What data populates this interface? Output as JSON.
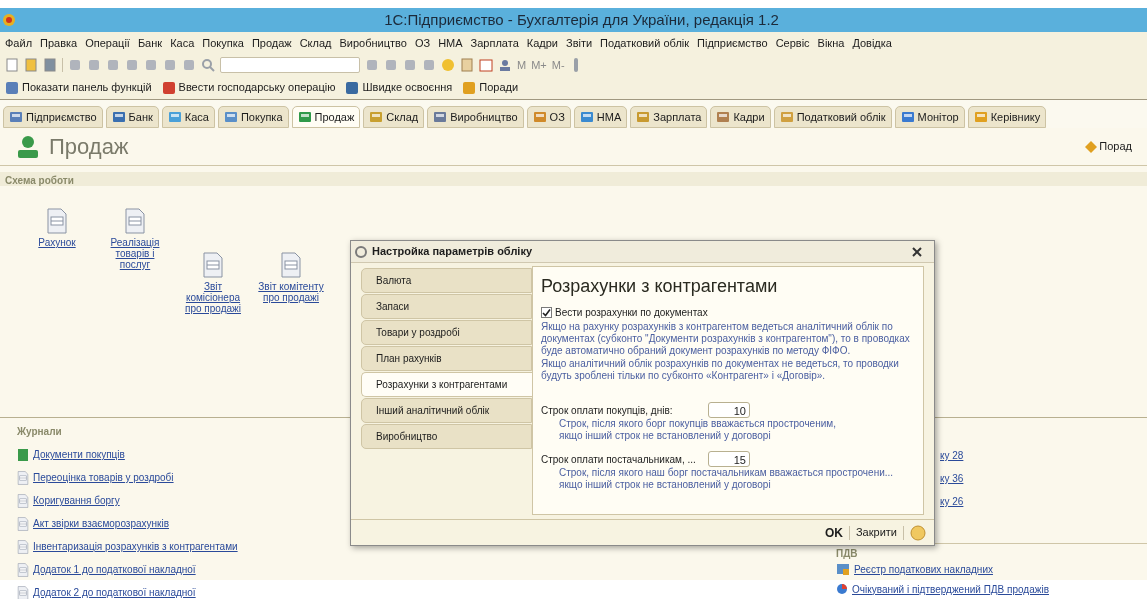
{
  "window": {
    "title": "1С:Підприємство - Бухгалтерія для України, редакція 1.2"
  },
  "menu": [
    "Файл",
    "Правка",
    "Операції",
    "Банк",
    "Каса",
    "Покупка",
    "Продаж",
    "Склад",
    "Виробництво",
    "ОЗ",
    "НМА",
    "Зарплата",
    "Кадри",
    "Звіти",
    "Податковий облік",
    "Підприємство",
    "Сервіс",
    "Вікна",
    "Довідка"
  ],
  "toolbar": {
    "memory_buttons": [
      "M",
      "M+",
      "M-"
    ]
  },
  "function_bar": [
    "Показати панель функцій",
    "Ввести господарську операцію",
    "Швидке освоєння",
    "Поради"
  ],
  "tabs": [
    {
      "label": "Підприємство",
      "selected": false
    },
    {
      "label": "Банк",
      "selected": false
    },
    {
      "label": "Каса",
      "selected": false
    },
    {
      "label": "Покупка",
      "selected": false
    },
    {
      "label": "Продаж",
      "selected": true
    },
    {
      "label": "Склад",
      "selected": false
    },
    {
      "label": "Виробництво",
      "selected": false
    },
    {
      "label": "ОЗ",
      "selected": false
    },
    {
      "label": "НМА",
      "selected": false
    },
    {
      "label": "Зарплата",
      "selected": false
    },
    {
      "label": "Кадри",
      "selected": false
    },
    {
      "label": "Податковий облік",
      "selected": false
    },
    {
      "label": "Монітор",
      "selected": false
    },
    {
      "label": "Керівнику",
      "selected": false
    }
  ],
  "page": {
    "title": "Продаж",
    "tips_link": "Порад"
  },
  "schema": {
    "title": "Схема роботи",
    "items": [
      {
        "label": "Рахунок"
      },
      {
        "label": "Реалізація товарів і послуг"
      },
      {
        "label": "Звіт комісіонера про продажі"
      },
      {
        "label": "Звіт комітенту про продажі"
      }
    ]
  },
  "journals": {
    "title": "Журнали",
    "items": [
      {
        "label": "Документи покупців",
        "kind": "journal"
      },
      {
        "label": "Переоцінка товарів у роздробі",
        "kind": "document"
      },
      {
        "label": "Коригування боргу",
        "kind": "document"
      },
      {
        "label": "Акт звірки взаєморозрахунків",
        "kind": "document"
      },
      {
        "label": "Інвентаризація розрахунків з контрагентами",
        "kind": "document"
      },
      {
        "label": "Додаток 1 до податкової накладної",
        "kind": "document"
      },
      {
        "label": "Додаток 2 до податкової накладної",
        "kind": "document"
      }
    ]
  },
  "reports": {
    "items": [
      "ку 28",
      "ку 36",
      "ку 26"
    ]
  },
  "vat": {
    "title": "ПДВ",
    "items": [
      {
        "label": "Реєстр податкових накладних",
        "kind": "register"
      },
      {
        "label": "Очікуваний і підтверджений ПДВ продажів",
        "kind": "report"
      }
    ]
  },
  "dialog": {
    "title": "Настройка параметрів обліку",
    "tabs": [
      {
        "label": "Валюта",
        "selected": false
      },
      {
        "label": "Запаси",
        "selected": false
      },
      {
        "label": "Товари у роздробі",
        "selected": false
      },
      {
        "label": "План рахунків",
        "selected": false
      },
      {
        "label": "Розрахунки з контрагентами",
        "selected": true
      },
      {
        "label": "Інший аналітичний облік",
        "selected": false
      },
      {
        "label": "Виробництво",
        "selected": false
      }
    ],
    "heading": "Розрахунки з контрагентами",
    "checkbox": {
      "label": "Вести розрахунки по документах",
      "checked": true
    },
    "description": [
      "Якщо на рахунку розрахунків з контрагентом ведеться аналітичний облік по документах (субконто \"Документи розрахунків з контрагентом\"), то в проводках буде автоматично обраний  документ розрахунків по методу ФІФО.",
      "Якщо аналітичний облік розрахунків по документах не ведеться, то проводки будуть зроблені тільки по субконто «Контрагент» і «Договір»."
    ],
    "fields": [
      {
        "label": "Строк оплати покупців, днів:",
        "value": "10",
        "hint": [
          "Строк, після якого борг покупців вважається простроченим,",
          "якщо інший строк не встановлений у договорі"
        ]
      },
      {
        "label": "Строк оплати постачальникам, ...",
        "value": "15",
        "hint": [
          "Строк, після якого наш борг постачальникам вважається прострочени...",
          "якщо інший строк не встановлений у договорі"
        ]
      }
    ],
    "ok": "OK",
    "close": "Закрити"
  }
}
